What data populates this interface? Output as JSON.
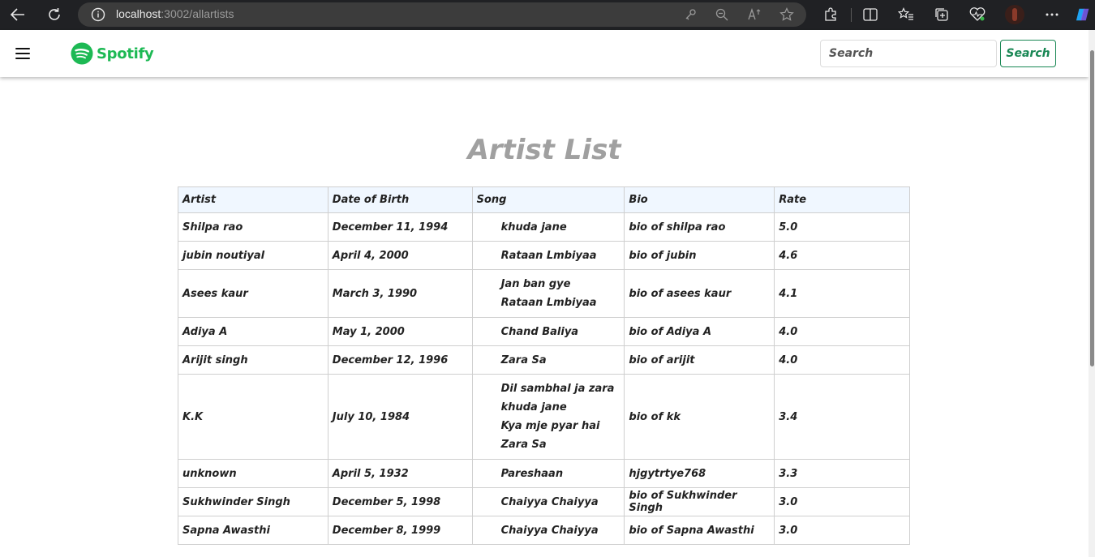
{
  "browser": {
    "url_host": "localhost",
    "url_rest": ":3002/allartists"
  },
  "navbar": {
    "brand": "Spotify",
    "search_placeholder": "Search",
    "search_button": "Search"
  },
  "page_title": "Artist List",
  "table": {
    "headers": [
      "Artist",
      "Date of Birth",
      "Song",
      "Bio",
      "Rate"
    ],
    "rows": [
      {
        "artist": "Shilpa rao",
        "dob": "December 11, 1994",
        "songs": [
          "khuda jane"
        ],
        "bio": "bio of shilpa rao",
        "rate": "5.0"
      },
      {
        "artist": "jubin noutiyal",
        "dob": "April 4, 2000",
        "songs": [
          "Rataan Lmbiyaa"
        ],
        "bio": "bio of jubin",
        "rate": "4.6"
      },
      {
        "artist": "Asees kaur",
        "dob": "March 3, 1990",
        "songs": [
          "Jan ban gye",
          "Rataan Lmbiyaa"
        ],
        "bio": "bio of asees kaur",
        "rate": "4.1"
      },
      {
        "artist": "Adiya A",
        "dob": "May 1, 2000",
        "songs": [
          "Chand Baliya"
        ],
        "bio": "bio of Adiya A",
        "rate": "4.0"
      },
      {
        "artist": "Arijit singh",
        "dob": "December 12, 1996",
        "songs": [
          "Zara Sa"
        ],
        "bio": "bio of arijit",
        "rate": "4.0"
      },
      {
        "artist": "K.K",
        "dob": "July 10, 1984",
        "songs": [
          "Dil sambhal ja zara",
          "khuda jane",
          "Kya mje pyar hai",
          "Zara Sa"
        ],
        "bio": "bio of kk",
        "rate": "3.4"
      },
      {
        "artist": "unknown",
        "dob": "April 5, 1932",
        "songs": [
          "Pareshaan"
        ],
        "bio": "hjgytrtye768",
        "rate": "3.3"
      },
      {
        "artist": "Sukhwinder Singh",
        "dob": "December 5, 1998",
        "songs": [
          "Chaiyya Chaiyya"
        ],
        "bio": "bio of Sukhwinder Singh",
        "rate": "3.0"
      },
      {
        "artist": "Sapna Awasthi",
        "dob": "December 8, 1999",
        "songs": [
          "Chaiyya Chaiyya"
        ],
        "bio": "bio of Sapna Awasthi",
        "rate": "3.0"
      }
    ]
  }
}
